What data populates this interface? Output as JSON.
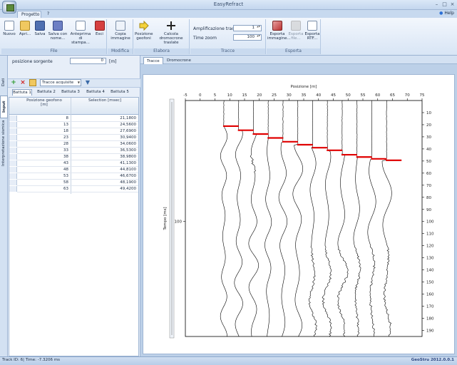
{
  "window": {
    "title": "EasyRefract"
  },
  "ribbon_tabs": {
    "progetto": "Progetto",
    "q": "?",
    "help": "Help"
  },
  "ribbon": {
    "file": {
      "label": "File",
      "nuovo": "Nuovo",
      "apri": "Apri...",
      "salva": "Salva",
      "salva_con_nome": "Salva con nome...",
      "anteprima": "Anteprima di stampa...",
      "esci": "Esci"
    },
    "modifica": {
      "label": "Modifica",
      "copia": "Copia immagine"
    },
    "elabora": {
      "label": "Elabora",
      "posizione": "Posizione geofoni",
      "calcola": "Calcola dromocrone traslate"
    },
    "tracce": {
      "label": "Tracce",
      "amplificazione_label": "Amplificazione tracce",
      "amplificazione_value": "1",
      "time_zoom_label": "Time zoom",
      "time_zoom_value": "100"
    },
    "esporta": {
      "label": "Esporta",
      "immagine": "Esporta immagine...",
      "file_dat": "Esporta file...",
      "rtf": "Esporta RTF..."
    }
  },
  "left": {
    "vtabs": [
      "Dati generali",
      "Input dati",
      "Interpretazione sismica"
    ],
    "posizione_label": "posizione sorgente",
    "posizione_value": "0",
    "posizione_unit": "[m]",
    "combo": "Tracce acquisite",
    "battute": [
      "Battuta 1",
      "Battuta 2",
      "Battuta 3",
      "Battuta 4",
      "Battuta 5"
    ],
    "grid": {
      "col1": "Posizione geofono [m]",
      "col2": "Selection [msec]",
      "rows": [
        [
          "8",
          "21,1800"
        ],
        [
          "13",
          "24,5600"
        ],
        [
          "18",
          "27,6900"
        ],
        [
          "23",
          "30,9400"
        ],
        [
          "28",
          "34,0600"
        ],
        [
          "33",
          "36,5300"
        ],
        [
          "38",
          "38,9800"
        ],
        [
          "43",
          "41,1300"
        ],
        [
          "48",
          "44,8100"
        ],
        [
          "53",
          "46,6700"
        ],
        [
          "58",
          "48,1900"
        ],
        [
          "63",
          "49,4200"
        ]
      ]
    }
  },
  "content_tabs": {
    "tracce": "Tracce",
    "dromocrone": "Dromocrone"
  },
  "chart_data": {
    "type": "line",
    "xlabel": "Posizione [m]",
    "ylabel": "Tempo [ms]",
    "x_ticks": [
      -5,
      0,
      5,
      10,
      15,
      20,
      25,
      30,
      35,
      40,
      45,
      50,
      55,
      60,
      65,
      70,
      75
    ],
    "y_ticks": [
      10,
      20,
      30,
      40,
      50,
      60,
      70,
      80,
      90,
      100,
      110,
      120,
      130,
      140,
      150,
      160,
      170,
      180,
      190
    ],
    "y_left_mark": 100,
    "xlim": [
      -5,
      75
    ],
    "ylim": [
      0,
      195
    ],
    "traces_x": [
      8,
      13,
      18,
      23,
      28,
      33,
      38,
      43,
      48,
      53,
      58,
      63
    ],
    "picks_ms": [
      21.18,
      24.56,
      27.69,
      30.94,
      34.06,
      36.53,
      38.98,
      41.13,
      44.81,
      46.67,
      48.19,
      49.42
    ]
  },
  "status": {
    "left": "Track ID: 6| Time: -7.3206 ms",
    "right": "GeoStru 2012.0.0.1"
  },
  "colors": {
    "pick": "#e00000",
    "trace": "#000000",
    "accent": "#2b4580"
  }
}
